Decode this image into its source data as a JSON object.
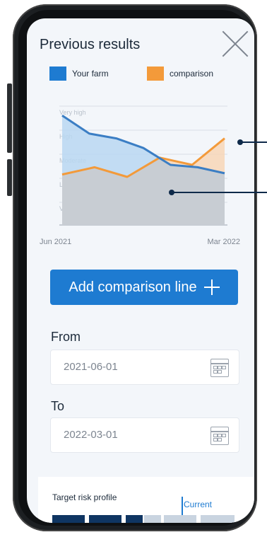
{
  "header": {
    "title": "Previous results"
  },
  "legend": [
    {
      "label": "Your farm",
      "color": "#1e7bd1"
    },
    {
      "label": "comparison",
      "color": "#f39a3a"
    }
  ],
  "chart_data": {
    "type": "area",
    "y_bands": [
      "Very high",
      "High",
      "Moderate",
      "Low",
      "Very low"
    ],
    "x_labels": [
      "Jun 2021",
      "Mar 2022"
    ],
    "series": [
      {
        "name": "Your farm",
        "values": [
          4.55,
          3.8,
          3.6,
          3.2,
          2.5,
          2.4,
          2.15
        ]
      },
      {
        "name": "comparison",
        "values": [
          2.1,
          2.4,
          2.0,
          2.8,
          2.5,
          3.6
        ]
      }
    ]
  },
  "add_button": {
    "label": "Add comparison line"
  },
  "from": {
    "label": "From",
    "value": "2021-06-01"
  },
  "to": {
    "label": "To",
    "value": "2022-03-01"
  },
  "target": {
    "label": "Target risk profile",
    "current": "Current"
  }
}
